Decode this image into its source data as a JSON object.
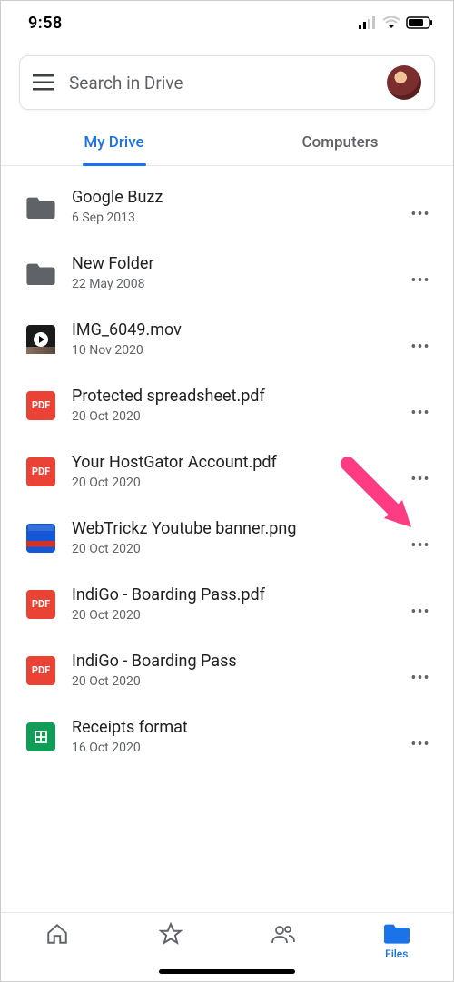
{
  "status": {
    "time": "9:58"
  },
  "search": {
    "placeholder": "Search in Drive"
  },
  "tabs": [
    {
      "label": "My Drive",
      "active": true
    },
    {
      "label": "Computers",
      "active": false
    }
  ],
  "files": [
    {
      "name": "Google Buzz",
      "date": "6 Sep 2013",
      "icon": "folder"
    },
    {
      "name": "New Folder",
      "date": "22 May 2008",
      "icon": "folder"
    },
    {
      "name": "IMG_6049.mov",
      "date": "10 Nov 2020",
      "icon": "video"
    },
    {
      "name": "Protected spreadsheet.pdf",
      "date": "20 Oct 2020",
      "icon": "pdf"
    },
    {
      "name": "Your HostGator Account.pdf",
      "date": "20 Oct 2020",
      "icon": "pdf"
    },
    {
      "name": "WebTrickz Youtube banner.png",
      "date": "20 Oct 2020",
      "icon": "image"
    },
    {
      "name": "IndiGo - Boarding Pass.pdf",
      "date": "20 Oct 2020",
      "icon": "pdf"
    },
    {
      "name": "IndiGo - Boarding Pass",
      "date": "20 Oct 2020",
      "icon": "pdf"
    },
    {
      "name": "Receipts format",
      "date": "16 Oct 2020",
      "icon": "sheet"
    }
  ],
  "icon_labels": {
    "pdf": "PDF"
  },
  "nav": {
    "home": "Home",
    "starred": "Starred",
    "shared": "Shared",
    "files": "Files"
  },
  "annotation": {
    "arrow_target": "file-row-4-more"
  }
}
